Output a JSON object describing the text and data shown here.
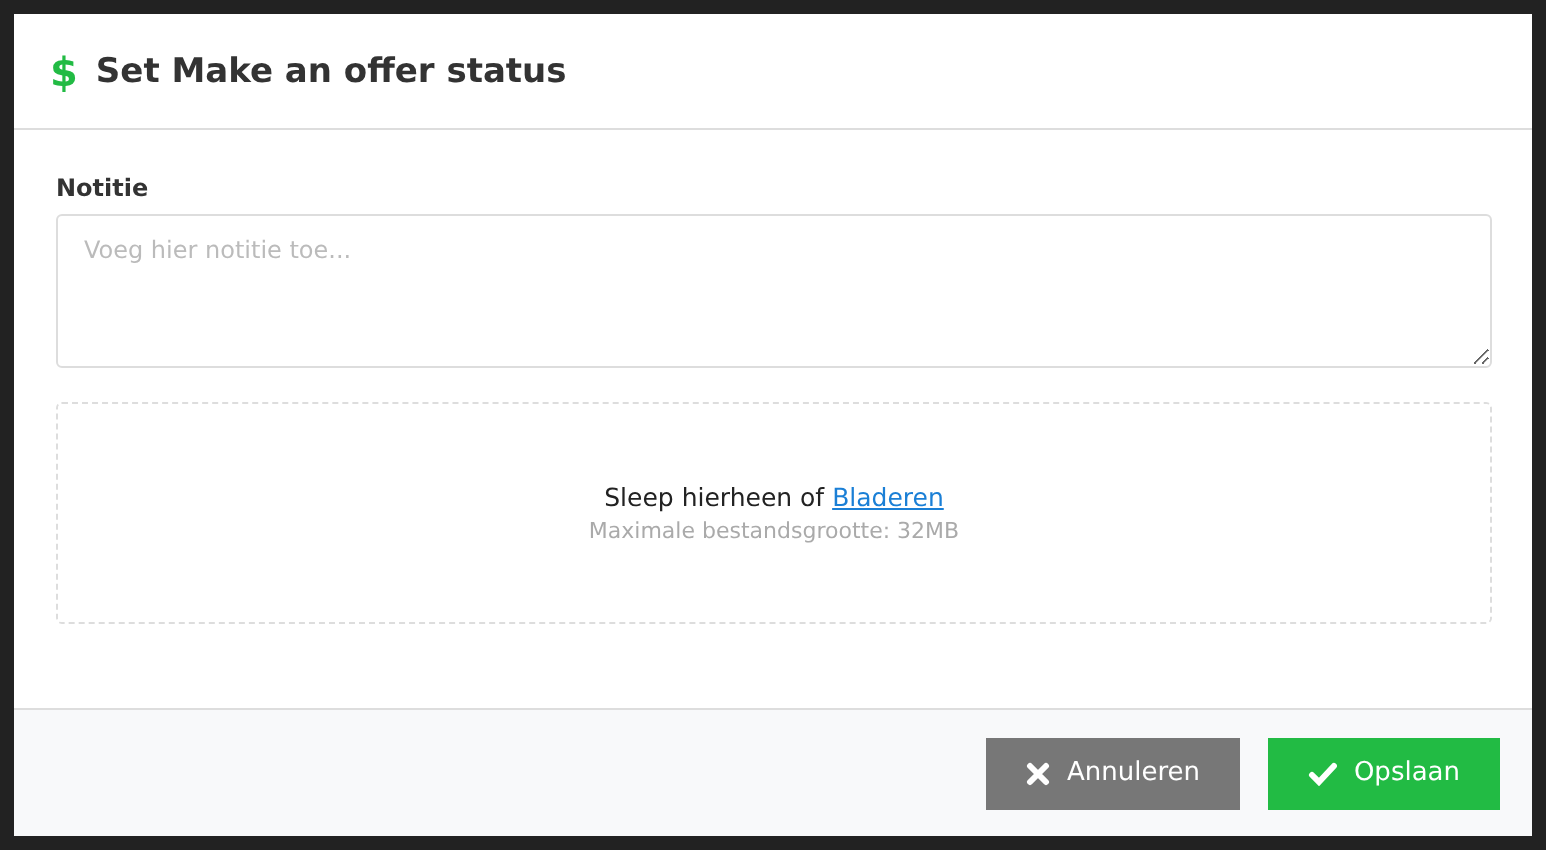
{
  "dialog": {
    "icon": "$",
    "title": "Set Make an offer status"
  },
  "note": {
    "label": "Notitie",
    "placeholder": "Voeg hier notitie toe..."
  },
  "dropzone": {
    "text": "Sleep hierheen of",
    "link": "Bladeren",
    "hint": "Maximale bestandsgrootte: 32MB"
  },
  "buttons": [
    {
      "kind": "cancel",
      "label": "Annuleren"
    },
    {
      "kind": "save",
      "label": "Opslaan"
    }
  ]
}
